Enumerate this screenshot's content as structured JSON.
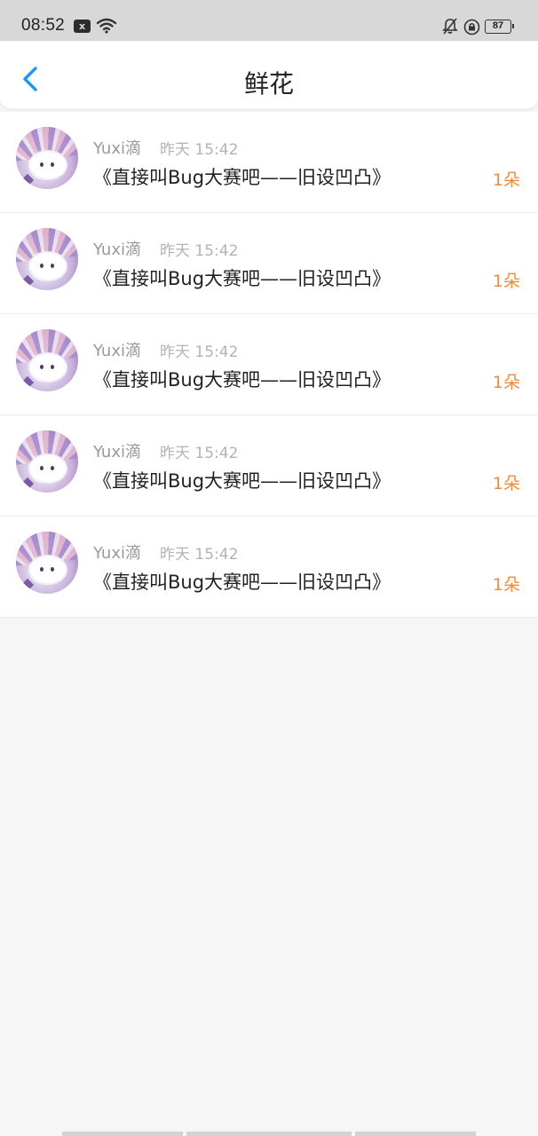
{
  "status_bar": {
    "time": "08:52",
    "notification_icon": "x",
    "battery": "87"
  },
  "header": {
    "title": "鲜花",
    "back_icon": "chevron-left-icon",
    "accent_color": "#2196f3"
  },
  "list": [
    {
      "username": "Yuxi滴",
      "time": "昨天 15:42",
      "post_title": "《直接叫Bug大赛吧——旧设凹凸》",
      "count": "1朵"
    },
    {
      "username": "Yuxi滴",
      "time": "昨天 15:42",
      "post_title": "《直接叫Bug大赛吧——旧设凹凸》",
      "count": "1朵"
    },
    {
      "username": "Yuxi滴",
      "time": "昨天 15:42",
      "post_title": "《直接叫Bug大赛吧——旧设凹凸》",
      "count": "1朵"
    },
    {
      "username": "Yuxi滴",
      "time": "昨天 15:42",
      "post_title": "《直接叫Bug大赛吧——旧设凹凸》",
      "count": "1朵"
    },
    {
      "username": "Yuxi滴",
      "time": "昨天 15:42",
      "post_title": "《直接叫Bug大赛吧——旧设凹凸》",
      "count": "1朵"
    }
  ],
  "colors": {
    "count": "#f08a3c",
    "username": "#999999",
    "background": "#f7f6f7"
  }
}
